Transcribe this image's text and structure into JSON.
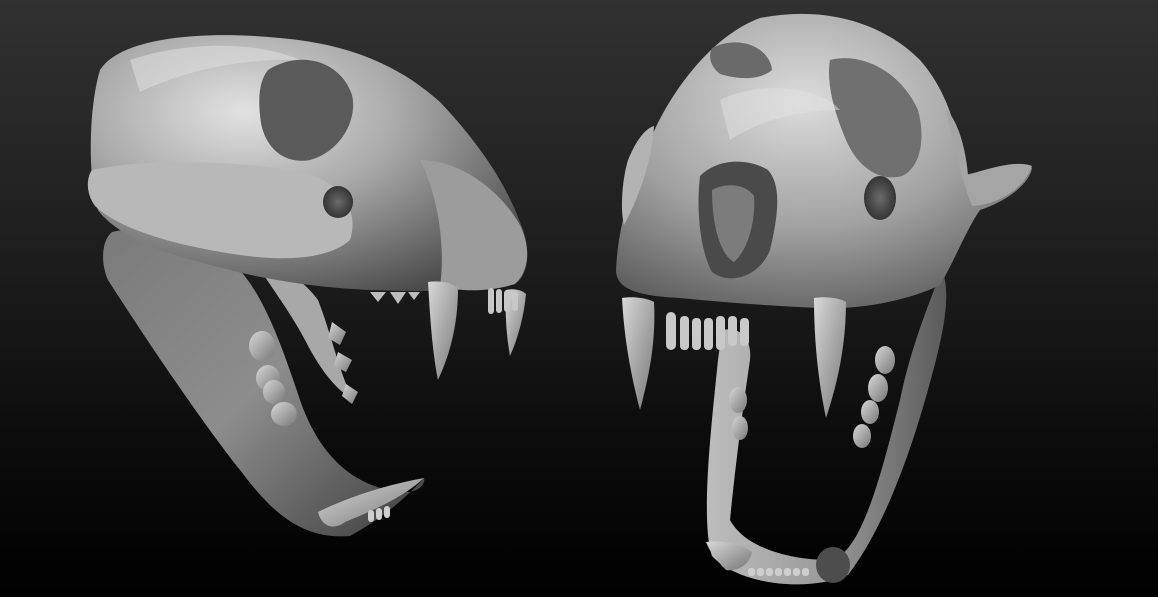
{
  "scene": {
    "subject_count": 2,
    "background_gradient": [
      "#313131",
      "#1c1c1c",
      "#0b0b0b",
      "#000000"
    ],
    "clay_palette": {
      "highlight": "#e6e6e6",
      "light": "#bdbdbd",
      "mid": "#8d8d8d",
      "dark": "#505050",
      "deep": "#1a1a1a"
    }
  }
}
